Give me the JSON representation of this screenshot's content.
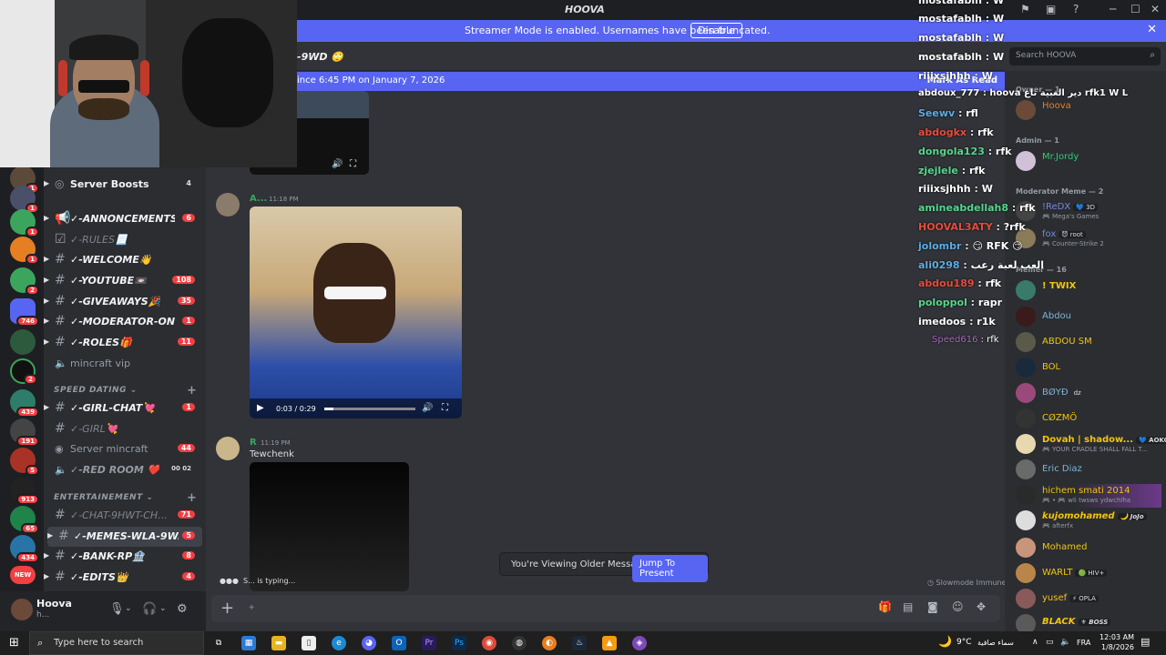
{
  "window": {
    "title": "HOOVA",
    "controls": {
      "min": "─",
      "max": "☐",
      "close": "✕"
    }
  },
  "banner": {
    "text": "Streamer Mode is enabled. Usernames have been truncated.",
    "disable_label": "Disable"
  },
  "channel_header": {
    "name": "-9WD 🙄"
  },
  "unread": {
    "text": "ince 6:45 PM on January 7, 2026",
    "mark_label": "Mark As Read"
  },
  "sidebar": {
    "server_boosts": {
      "label": "Server Boosts",
      "count": "4"
    },
    "channels": [
      {
        "name": "✓-ANNONCEMENTS...",
        "badge": "6"
      },
      {
        "name": "✓-RULES📃",
        "badge": ""
      },
      {
        "name": "✓-WELCOME👋",
        "badge": ""
      },
      {
        "name": "✓-YOUTUBE📼",
        "badge": "108"
      },
      {
        "name": "✓-GIVEAWAYS🎉",
        "badge": "35"
      },
      {
        "name": "✓-MODERATOR-ON...",
        "badge": "1"
      },
      {
        "name": "✓-ROLES🎁",
        "badge": "11"
      },
      {
        "name": "mincraft vip",
        "badge": ""
      }
    ],
    "category_speed": "SPEED DATING",
    "speed_channels": [
      {
        "name": "✓-GIRL-CHAT💘",
        "badge": "1"
      },
      {
        "name": "✓-GIRL💘",
        "badge": ""
      },
      {
        "name": "Server mincraft",
        "badge": "44"
      },
      {
        "name": "✓-RED ROOM ❤️",
        "badge": "00 02"
      }
    ],
    "category_ent": "ENTERTAINEMENT",
    "ent_channels": [
      {
        "name": "✓-CHAT-9HWT-CH...",
        "badge": "71"
      },
      {
        "name": "✓-MEMES-WLA-9W...",
        "badge": "5"
      },
      {
        "name": "✓-BANK-RP🏦",
        "badge": "8"
      },
      {
        "name": "✓-EDITS👑",
        "badge": "4"
      }
    ]
  },
  "server_badges": [
    "1",
    "1",
    "1",
    "1",
    "2",
    "746",
    "",
    "2",
    "439",
    "191",
    "5",
    "913",
    "65",
    "434",
    "NEW"
  ],
  "user": {
    "name": "Hoova",
    "status": "h..."
  },
  "messages": [
    {
      "author": "A...",
      "time": "11:18 PM",
      "video_time": "0:03 / 0:29"
    },
    {
      "author": "R",
      "time": "11:19 PM",
      "text": "Tewchenk"
    }
  ],
  "older": {
    "text": "You're Viewing Older Messages",
    "button": "Jump To Present"
  },
  "typing": "S... is typing...",
  "slowmode": "Slowmode Immune",
  "search": {
    "placeholder": "Search HOOVA"
  },
  "members": {
    "groups": [
      "Owner — 1",
      "Admin — 1",
      "Moderator Meme — 2",
      "Memer — 16"
    ],
    "list": [
      {
        "name": "Hoova",
        "color": "#e67e22",
        "sub": "",
        "tag": ""
      },
      {
        "name": "Mr.Jordy",
        "color": "#2ecc71",
        "sub": "",
        "tag": ""
      },
      {
        "name": "!ReDX",
        "color": "#7289da",
        "sub": "🎮 Mega's Games",
        "tag": "💙 3D"
      },
      {
        "name": "fox",
        "color": "#7289da",
        "sub": "🎮 Counter-Strike 2",
        "tag": "😈 root"
      },
      {
        "name": "! TWIX",
        "color": "#f1c40f",
        "sub": "",
        "tag": ""
      },
      {
        "name": "Abdou",
        "color": "#7fb3d5",
        "sub": "",
        "tag": ""
      },
      {
        "name": "ABDOU SM",
        "color": "#f1c40f",
        "sub": "",
        "tag": ""
      },
      {
        "name": "BOL",
        "color": "#f1c40f",
        "sub": "",
        "tag": ""
      },
      {
        "name": "BØYĐ",
        "color": "#7fb3d5",
        "sub": "",
        "tag": "dz"
      },
      {
        "name": "CØZMÖ",
        "color": "#f1c40f",
        "sub": "",
        "tag": ""
      },
      {
        "name": "Dovah | shadow...",
        "color": "#f1c40f",
        "sub": "🎮 YOUR CRADLE SHALL FALL T...",
        "tag": "💙 AOKO"
      },
      {
        "name": "Eric Diaz",
        "color": "#7fb3d5",
        "sub": "",
        "tag": ""
      },
      {
        "name": "hichem smati 2014",
        "color": "#f1c40f",
        "sub": "🎮 • 🎮 wli twsws ydwchlha",
        "tag": ""
      },
      {
        "name": "kujomohamed",
        "color": "#f1c40f",
        "sub": "🎮 afterfx",
        "tag": "🌙 JoJo"
      },
      {
        "name": "Mohamed",
        "color": "#f1c40f",
        "sub": "",
        "tag": ""
      },
      {
        "name": "WARLT",
        "color": "#f1c40f",
        "sub": "",
        "tag": "🟢 HIV+"
      },
      {
        "name": "yusef",
        "color": "#f1c40f",
        "sub": "",
        "tag": "⚡ OPLA"
      },
      {
        "name": "BLACK",
        "color": "#f1c40f",
        "sub": "",
        "tag": "⚜ BOSS"
      }
    ]
  },
  "chat_overlay": [
    {
      "user": "mostafablh",
      "msg": "W",
      "color": "#ffffff"
    },
    {
      "user": "mostafablh",
      "msg": "W",
      "color": "#ffffff"
    },
    {
      "user": "mostafablh",
      "msg": "W",
      "color": "#ffffff"
    },
    {
      "user": "mostafablh",
      "msg": "W",
      "color": "#ffffff"
    },
    {
      "user": "riiixsjhhh",
      "msg": "W",
      "color": "#ffffff"
    },
    {
      "user": "abdoux_777",
      "msg": "hoova دير الغبية تاع rfk1  W  L",
      "color": "#ffffff"
    },
    {
      "user": "Seewv",
      "msg": "rfl",
      "color": "#5dade2"
    },
    {
      "user": "abdogkx",
      "msg": "rfk",
      "color": "#e74c3c"
    },
    {
      "user": "dongola123",
      "msg": "rfk",
      "color": "#58d68d"
    },
    {
      "user": "zjejlele",
      "msg": "rfk",
      "color": "#58d68d"
    },
    {
      "user": "riiixsjhhh",
      "msg": "W",
      "color": "#ffffff"
    },
    {
      "user": "amineabdellah8",
      "msg": "rfk",
      "color": "#58d68d"
    },
    {
      "user": "HOOVAL3ATY",
      "msg": "?rfk",
      "color": "#e74c3c"
    },
    {
      "user": "jolombr",
      "msg": "😏 RFK 😏",
      "color": "#5dade2"
    },
    {
      "user": "ali0298",
      "msg": "العب لعبة رعب",
      "color": "#5dade2"
    },
    {
      "user": "abdou189",
      "msg": "rfk",
      "color": "#e74c3c"
    },
    {
      "user": "poloppol",
      "msg": "rapr",
      "color": "#58d68d"
    },
    {
      "user": "imedoos",
      "msg": "r1k",
      "color": "#ffffff"
    },
    {
      "user": "Speed616",
      "msg": "rfk",
      "color": "#a569bd"
    }
  ],
  "taskbar": {
    "search": "Type here to search",
    "weather": "9°C",
    "weather_desc": "سماء صافية",
    "lang": "FRA",
    "time": "12:03 AM",
    "date": "1/8/2026"
  }
}
